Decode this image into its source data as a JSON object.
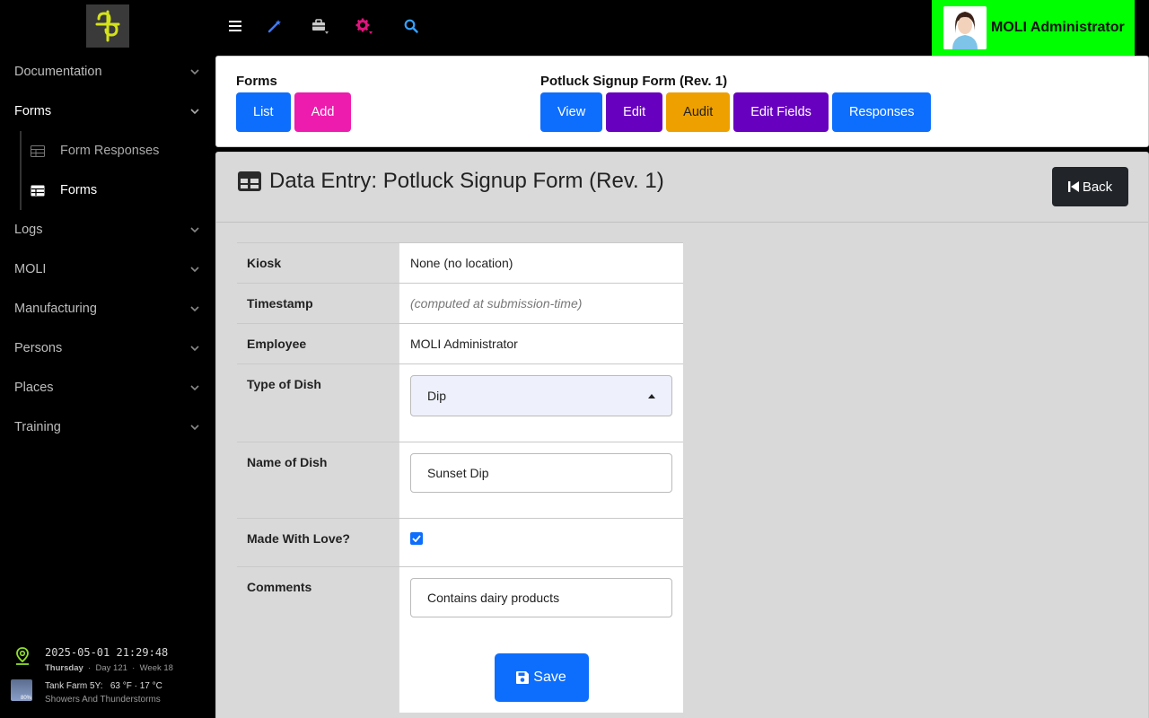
{
  "sidebar": {
    "logo_icon": "app-logo-icon",
    "items": [
      {
        "label": "Documentation"
      },
      {
        "label": "Forms"
      },
      {
        "label": "Logs"
      },
      {
        "label": "MOLI"
      },
      {
        "label": "Manufacturing"
      },
      {
        "label": "Persons"
      },
      {
        "label": "Places"
      },
      {
        "label": "Training"
      }
    ],
    "sub_items": [
      {
        "label": "Form Responses"
      },
      {
        "label": "Forms"
      }
    ],
    "footer": {
      "datetime": "2025-05-01 21:29:48",
      "weekday": "Thursday",
      "day": "Day 121",
      "week": "Week 18",
      "weather_location": "Tank Farm 5Y:",
      "weather_temp": "63 °F · 17 °C",
      "weather_desc": "Showers And Thunderstorms",
      "weather_badge": "80%"
    }
  },
  "topbar": {
    "user_name": "MOLI Administrator",
    "accent_color": "#00ff00"
  },
  "forms_panel": {
    "left_title": "Forms",
    "left_buttons": [
      "List",
      "Add"
    ],
    "right_title": "Potluck Signup Form (Rev. 1)",
    "right_buttons": [
      "View",
      "Edit",
      "Audit",
      "Edit Fields",
      "Responses"
    ]
  },
  "main": {
    "title": "Data Entry: Potluck Signup Form (Rev. 1)",
    "back_label": "Back",
    "fields": {
      "kiosk_label": "Kiosk",
      "kiosk_value": "None (no location)",
      "timestamp_label": "Timestamp",
      "timestamp_value": "(computed at submission-time)",
      "employee_label": "Employee",
      "employee_value": "MOLI Administrator",
      "dish_type_label": "Type of Dish",
      "dish_type_value": "Dip",
      "dish_name_label": "Name of Dish",
      "dish_name_value": "Sunset Dip",
      "love_label": "Made With Love?",
      "love_checked": true,
      "comments_label": "Comments",
      "comments_value": "Contains dairy products"
    },
    "save_label": "Save"
  }
}
